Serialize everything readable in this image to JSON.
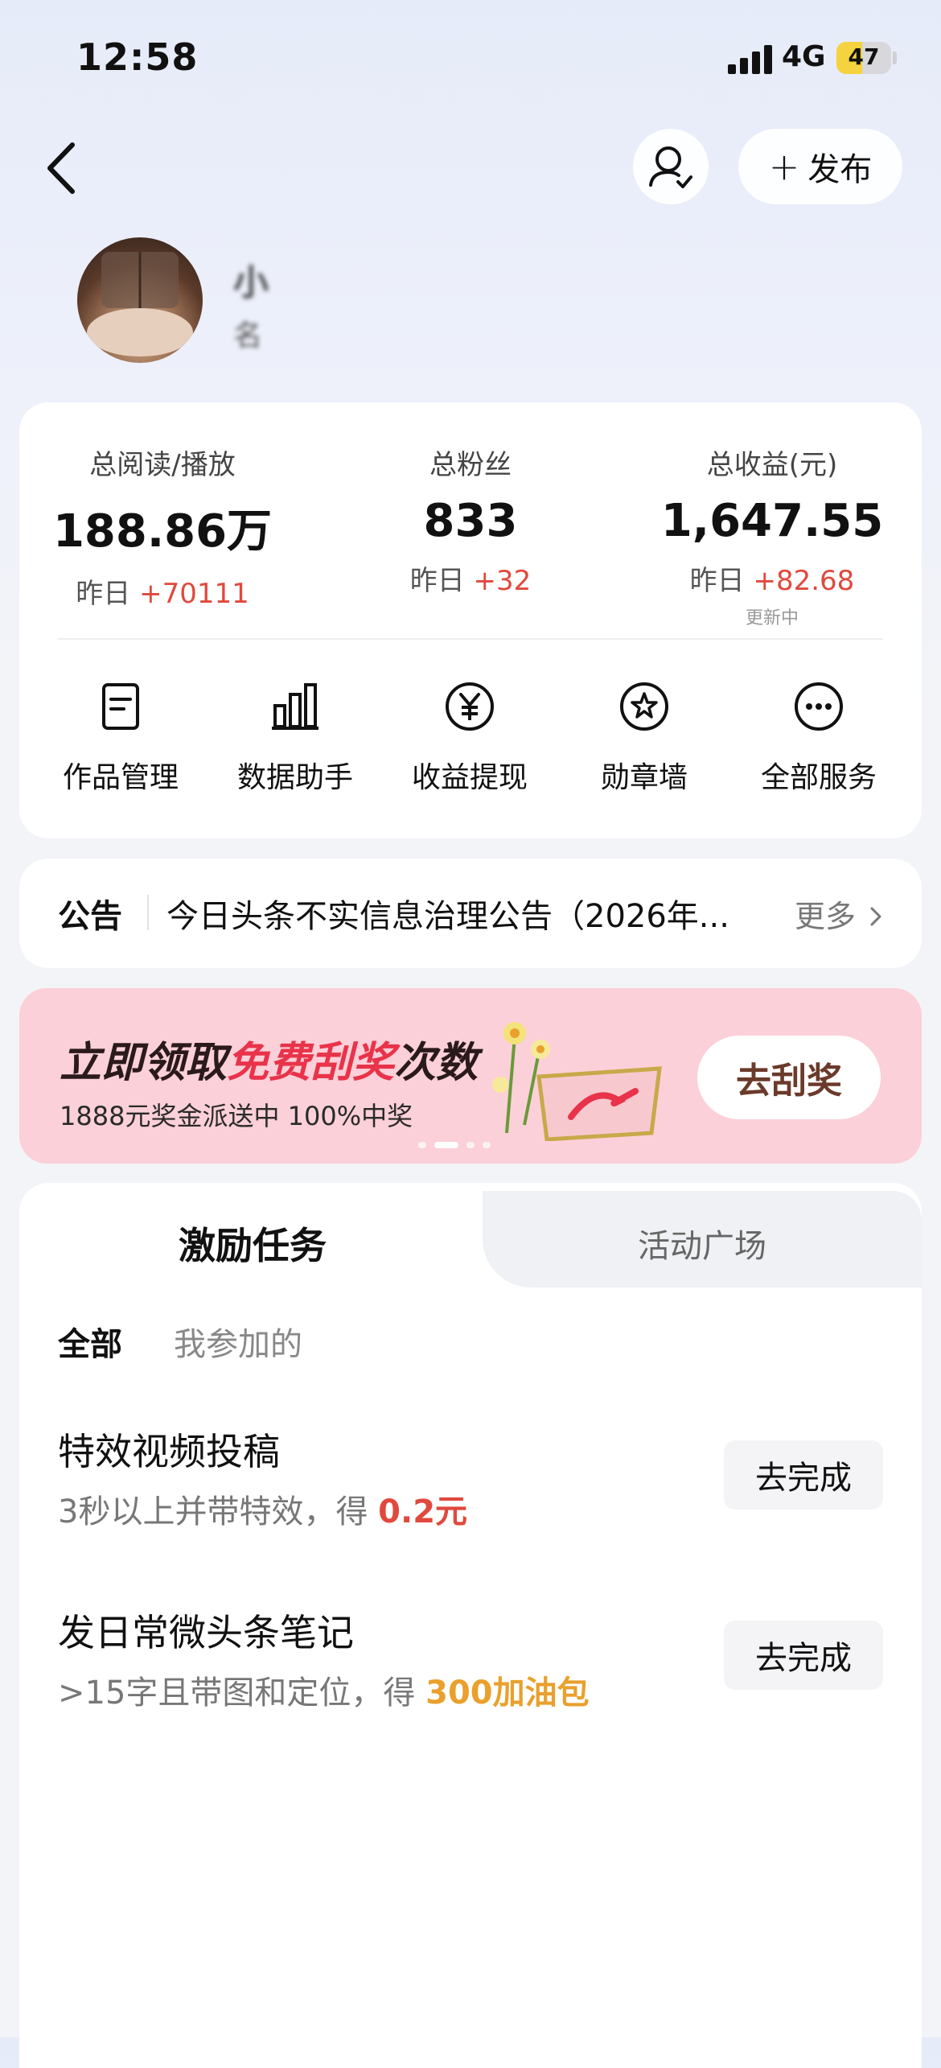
{
  "status_bar": {
    "time": "12:58",
    "network": "4G",
    "battery": "47",
    "battery_level": 0.47
  },
  "nav": {
    "publish_label": "发布"
  },
  "profile": {
    "name": "小",
    "subtitle": "名"
  },
  "stats": [
    {
      "label": "总阅读/播放",
      "value": "188.86万",
      "change_prefix": "昨日 ",
      "change": "+70111"
    },
    {
      "label": "总粉丝",
      "value": "833",
      "change_prefix": "昨日 ",
      "change": "+32"
    },
    {
      "label": "总收益(元)",
      "value": "1,647.55",
      "change_prefix": "昨日 ",
      "change": "+82.68"
    }
  ],
  "stats_note": "更新中",
  "services": [
    {
      "label": "作品管理",
      "icon": "document-icon"
    },
    {
      "label": "数据助手",
      "icon": "bar-chart-icon"
    },
    {
      "label": "收益提现",
      "icon": "yuan-icon"
    },
    {
      "label": "勋章墙",
      "icon": "medal-icon"
    },
    {
      "label": "全部服务",
      "icon": "more-icon"
    }
  ],
  "notice": {
    "title": "公告",
    "text": "今日头条不实信息治理公告（2026年...",
    "more": "更多"
  },
  "banner": {
    "title_prefix": "立即领取",
    "title_highlight": "免费刮奖",
    "title_suffix": "次数",
    "subtitle": "1888元奖金派送中 100%中奖",
    "button": "去刮奖",
    "highlight_color": "#e8334a"
  },
  "tabs": {
    "active": "激励任务",
    "inactive": "活动广场"
  },
  "filters": {
    "all": "全部",
    "mine": "我参加的"
  },
  "tasks": [
    {
      "title": "特效视频投稿",
      "desc_prefix": "3秒以上并带特效，得 ",
      "reward": "0.2元",
      "button": "去完成"
    },
    {
      "title": "发日常微头条笔记",
      "desc_prefix": ">15字且带图和定位，得 ",
      "reward": "300加油包",
      "button": "去完成"
    }
  ],
  "colors": {
    "positive": "#e0493e",
    "reward_orange": "#e9a02c",
    "banner_bg": "#fcd0d8"
  }
}
